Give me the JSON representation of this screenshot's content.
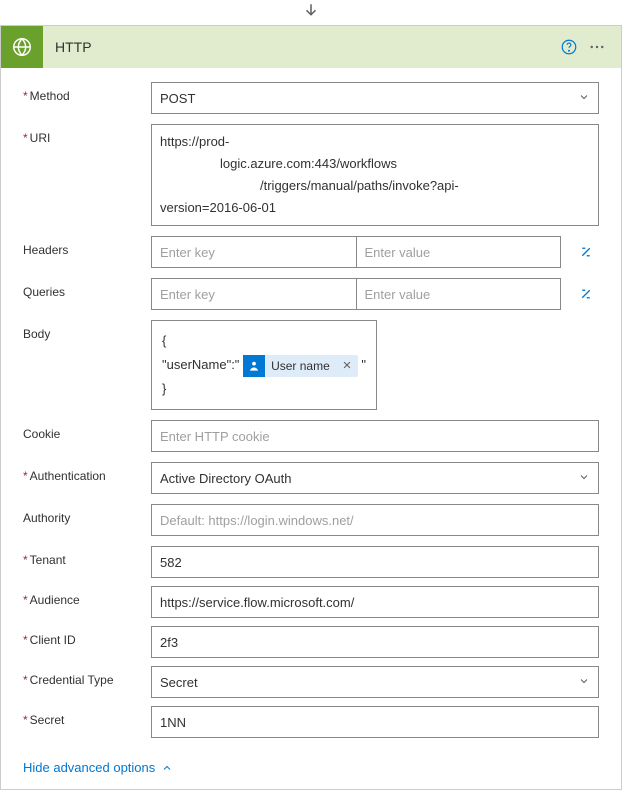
{
  "header": {
    "title": "HTTP"
  },
  "labels": {
    "method": "Method",
    "uri": "URI",
    "headers": "Headers",
    "queries": "Queries",
    "body": "Body",
    "cookie": "Cookie",
    "authentication": "Authentication",
    "authority": "Authority",
    "tenant": "Tenant",
    "audience": "Audience",
    "clientId": "Client ID",
    "credentialType": "Credential Type",
    "secret": "Secret"
  },
  "values": {
    "method": "POST",
    "uri_line1": "https://prod-",
    "uri_line2": "logic.azure.com:443/workflows",
    "uri_line3": "/triggers/manual/paths/invoke?api-",
    "uri_line4": "version=2016-06-01",
    "body_prefix": "{",
    "body_line2_left": "\"userName\":\"",
    "body_line2_right": "\"",
    "body_suffix": "}",
    "token_label": "User name",
    "cookie": "",
    "authentication": "Active Directory OAuth",
    "authority": "",
    "tenant": "582",
    "audience": "https://service.flow.microsoft.com/",
    "clientId": "2f3",
    "credentialType": "Secret",
    "secret": "1NN"
  },
  "placeholders": {
    "enterKey": "Enter key",
    "enterValue": "Enter value",
    "cookie": "Enter HTTP cookie",
    "authority": "Default: https://login.windows.net/"
  },
  "footer": {
    "hideAdvanced": "Hide advanced options"
  }
}
